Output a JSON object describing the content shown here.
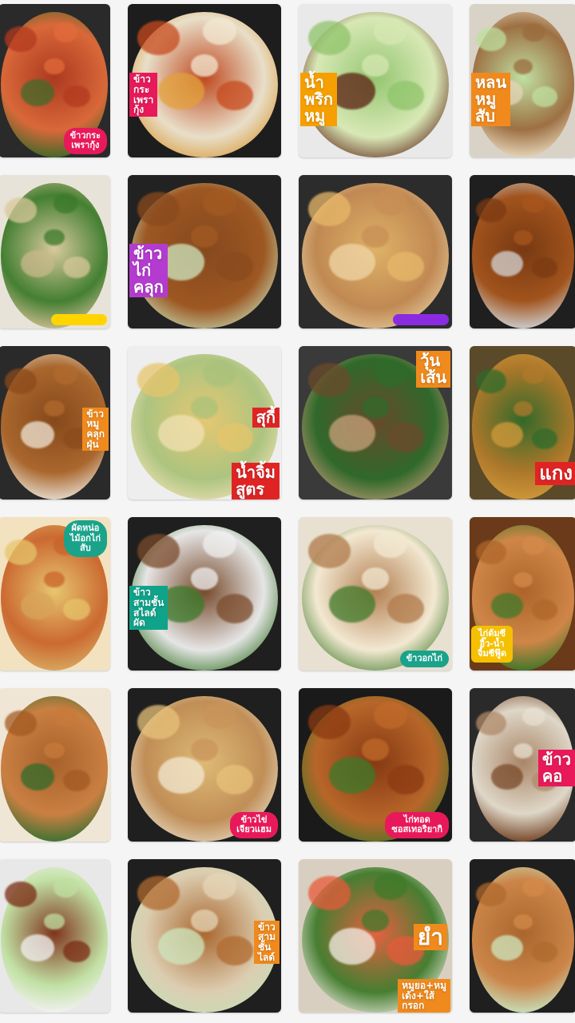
{
  "tiles": [
    {
      "name": "tile-shrimp-basil",
      "base": "#2a2a2a",
      "food": [
        "#b23a1f",
        "#e26b3a",
        "#3f6b2a"
      ],
      "labels": [],
      "sticker": {
        "text": "ข้าวกระ\nเพรากุ้ง",
        "color": "#e8195a"
      }
    },
    {
      "name": "tile-shrimp-egg",
      "base": "#1d1d1d",
      "food": [
        "#c74a1e",
        "#f3e9d2",
        "#e3a03b"
      ],
      "labels": [
        {
          "text": "ข้าว\nกระ\nเพรา\nกุ้ง",
          "color": "#e8195a",
          "pos": "left"
        }
      ],
      "sticker": null
    },
    {
      "name": "tile-chili-paste",
      "base": "#e9e9e9",
      "food": [
        "#8fc46a",
        "#d7e8b3",
        "#5a1e10"
      ],
      "labels": [
        {
          "text": "น้ำ\nพริก\nหมู",
          "color": "#f5a000",
          "pos": "left"
        }
      ],
      "sticker": null
    },
    {
      "name": "tile-pork-dip",
      "base": "#d9d2c7",
      "food": [
        "#bfe0a0",
        "#9a6b3c",
        "#e6d6b8"
      ],
      "labels": [
        {
          "text": "หลน\nหมู\nสับ",
          "color": "#f08a1c",
          "pos": "left"
        }
      ],
      "sticker": null
    },
    {
      "name": "tile-egg-soup",
      "base": "#e8e3d8",
      "food": [
        "#d8c89a",
        "#3b7a2a",
        "#c9b98a"
      ],
      "labels": [],
      "sticker": {
        "text": "",
        "color": "#ffd400"
      }
    },
    {
      "name": "tile-crispy-chicken-rice",
      "base": "#222",
      "food": [
        "#8a4a1e",
        "#a35a22",
        "#cfe8c0"
      ],
      "labels": [
        {
          "text": "ข้าว\nไก่\nคลุก",
          "color": "#b43bcf",
          "pos": "left"
        }
      ],
      "sticker": null
    },
    {
      "name": "tile-omelet-rice",
      "base": "#2c2c2c",
      "food": [
        "#e8b96a",
        "#c88e55",
        "#f0d7a8"
      ],
      "labels": [],
      "sticker": {
        "text": "",
        "color": "#8a2be2"
      }
    },
    {
      "name": "tile-fried-pork",
      "base": "#1f1f1f",
      "food": [
        "#7b3a12",
        "#a8561c",
        "#d4d4d4"
      ],
      "labels": [],
      "sticker": null
    },
    {
      "name": "tile-fried-pork-rice",
      "base": "#2a2a2a",
      "food": [
        "#8b4a1a",
        "#b06a2e",
        "#f0e6d6"
      ],
      "labels": [
        {
          "text": "ข้าว\nหมู\nคลุก\nฝุ่น",
          "color": "#f08a1c",
          "pos": "right"
        }
      ],
      "sticker": null
    },
    {
      "name": "tile-suki",
      "base": "#eeeeee",
      "food": [
        "#e6c56b",
        "#a9c27a",
        "#f2e2b4"
      ],
      "labels": [
        {
          "text": "สุกี้",
          "color": "#e02424",
          "pos": "right"
        },
        {
          "text": "น้ำจิ้ม\nสูตร",
          "color": "#e02424",
          "pos": "right-low"
        }
      ],
      "sticker": null
    },
    {
      "name": "tile-larb",
      "base": "#3a3a3a",
      "food": [
        "#6b4a2a",
        "#2f6b2a",
        "#c9a27a"
      ],
      "labels": [
        {
          "text": "วุ้น\nเส้น",
          "color": "#f08a1c",
          "pos": "right-top"
        }
      ],
      "sticker": null
    },
    {
      "name": "tile-curry-veg",
      "base": "#5a4a2a",
      "food": [
        "#2f6b2a",
        "#b07a2a",
        "#d49a3a"
      ],
      "labels": [
        {
          "text": "แกง",
          "color": "#e02424",
          "pos": "right-bottom"
        }
      ],
      "sticker": null
    },
    {
      "name": "tile-papaya-salad",
      "base": "#f3e2c0",
      "food": [
        "#e6c56b",
        "#c9632a",
        "#d7a55a"
      ],
      "labels": [],
      "sticker": {
        "text": "ผัดหน่อ\nไม้อกไก่\nสับ",
        "color": "#1aa38a"
      }
    },
    {
      "name": "tile-pork-stir-fry",
      "base": "#1f1f1f",
      "food": [
        "#7a4a2a",
        "#f0f0f0",
        "#3b7a2a"
      ],
      "labels": [
        {
          "text": "ข้าว\nสามชั้น\nสไลด์\nผัด",
          "color": "#0fa38a",
          "pos": "left"
        }
      ],
      "sticker": null
    },
    {
      "name": "tile-minced-egg",
      "base": "#e8e0d0",
      "food": [
        "#b07a4a",
        "#f3e9d2",
        "#3f7a2a"
      ],
      "labels": [],
      "sticker": {
        "text": "ข้าวอกไก่",
        "color": "#1aa38a"
      }
    },
    {
      "name": "tile-braised-chicken",
      "base": "#6b3a1a",
      "food": [
        "#b0662a",
        "#d48a4a",
        "#3f7a2a"
      ],
      "labels": [],
      "sticker": {
        "text": "ไก่ต้มซี\nอิ๊ว-น้ำ\nจิ้มซีฟู๊ด",
        "color": "#f5c000"
      }
    },
    {
      "name": "tile-chicken-leg",
      "base": "#f0e6d6",
      "food": [
        "#a35a22",
        "#c87a3a",
        "#2f6b2a"
      ],
      "labels": [],
      "sticker": null
    },
    {
      "name": "tile-omelet-rice-2",
      "base": "#1f1f1f",
      "food": [
        "#e8c27a",
        "#c9945a",
        "#f3e9d2"
      ],
      "labels": [],
      "sticker": {
        "text": "ข้าวไข่\nเจียวแฮม",
        "color": "#e8195a"
      }
    },
    {
      "name": "tile-garlic-pork",
      "base": "#1a1a1a",
      "food": [
        "#8b3a12",
        "#c06a2a",
        "#3b7a2a"
      ],
      "labels": [],
      "sticker": {
        "text": "ไก่ทอด\nซอสเทอริยากิ",
        "color": "#e8195a"
      }
    },
    {
      "name": "tile-pork-rice",
      "base": "#2a2a2a",
      "food": [
        "#b08a6a",
        "#e8e0d0",
        "#7a4a2a"
      ],
      "labels": [
        {
          "text": "ข้าว\nคอ",
          "color": "#e8195a",
          "pos": "right"
        }
      ],
      "sticker": null
    },
    {
      "name": "tile-crispy-pork-veg",
      "base": "#e8e8e8",
      "food": [
        "#7a2a12",
        "#bfe0a0",
        "#f3f3f3"
      ],
      "labels": [],
      "sticker": null
    },
    {
      "name": "tile-crispy-pork-rice",
      "base": "#1f1f1f",
      "food": [
        "#b06a2e",
        "#e6d6b8",
        "#cfe8c0"
      ],
      "labels": [
        {
          "text": "ข้าว\nสาม\nชั้น\nไลด์",
          "color": "#f08a1c",
          "pos": "right"
        }
      ],
      "sticker": null
    },
    {
      "name": "tile-yum-salad",
      "base": "#d9cfc0",
      "food": [
        "#e85a3a",
        "#3f7a2a",
        "#f3efe6"
      ],
      "labels": [
        {
          "text": "ยำ",
          "color": "#f08a1c",
          "pos": "right-mid"
        },
        {
          "text": "หมูยอ+หมู\nเด้ง+ใส้\nกรอก",
          "color": "#f08a1c",
          "pos": "right-low"
        }
      ],
      "sticker": null
    },
    {
      "name": "tile-crispy-chicken",
      "base": "#1f1f1f",
      "food": [
        "#b06a2e",
        "#d48a4a",
        "#cfe8c0"
      ],
      "labels": [],
      "sticker": null
    }
  ]
}
